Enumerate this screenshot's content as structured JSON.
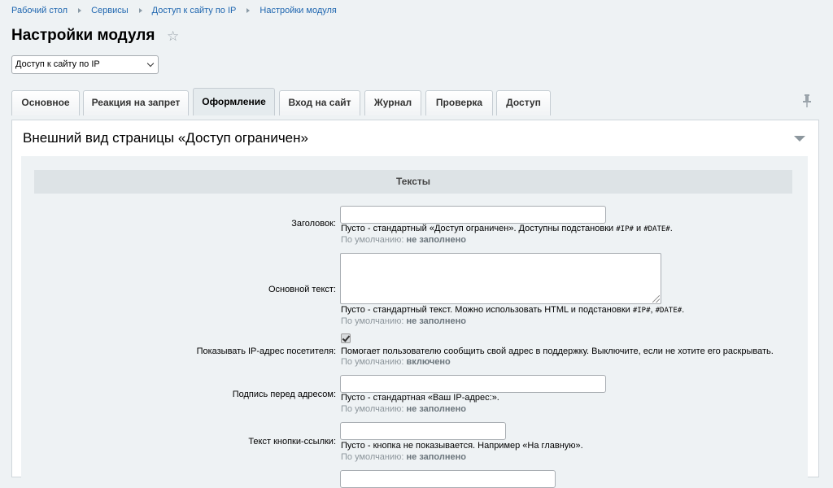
{
  "breadcrumb": [
    "Рабочий стол",
    "Сервисы",
    "Доступ к сайту по IP",
    "Настройки модуля"
  ],
  "page_title": "Настройки модуля",
  "module_select": {
    "value": "Доступ к сайту по IP"
  },
  "tabs": [
    {
      "label": "Основное"
    },
    {
      "label": "Реакция на запрет"
    },
    {
      "label": "Оформление",
      "active": true
    },
    {
      "label": "Вход на сайт"
    },
    {
      "label": "Журнал"
    },
    {
      "label": "Проверка"
    },
    {
      "label": "Доступ"
    }
  ],
  "section": {
    "title": "Внешний вид страницы «Доступ ограничен»",
    "group_title": "Тексты"
  },
  "fields": {
    "heading": {
      "label": "Заголовок:",
      "value": "",
      "hint_text": "Пусто - стандартный «Доступ ограничен». Доступны подстановки ",
      "hint_code1": "#IP#",
      "hint_mid": " и ",
      "hint_code2": "#DATE#",
      "hint_end": ".",
      "default_label": "По умолчанию:",
      "default_value": "не заполнено"
    },
    "main_text": {
      "label": "Основной текст:",
      "value": "",
      "hint_text": "Пусто - стандартный текст. Можно использовать HTML и подстановки ",
      "hint_code1": "#IP#",
      "hint_mid": ", ",
      "hint_code2": "#DATE#",
      "hint_end": ".",
      "default_label": "По умолчанию:",
      "default_value": "не заполнено"
    },
    "show_ip": {
      "label": "Показывать IP-адрес посетителя:",
      "checked": true,
      "hint_text": "Помогает пользователю сообщить свой адрес в поддержку. Выключите, если не хотите его раскрывать.",
      "default_label": "По умолчанию:",
      "default_value": "включено"
    },
    "ip_caption": {
      "label": "Подпись перед адресом:",
      "value": "",
      "hint_text": "Пусто - стандартная «Ваш IP-адрес:».",
      "default_label": "По умолчанию:",
      "default_value": "не заполнено"
    },
    "link_button": {
      "label": "Текст кнопки-ссылки:",
      "value": "",
      "hint_text": "Пусто - кнопка не показывается. Например «На главную».",
      "default_label": "По умолчанию:",
      "default_value": "не заполнено"
    }
  },
  "icons": {
    "star": "star-icon",
    "pin": "pin-icon",
    "collapse": "triangle-down-icon",
    "select": "chevron-down-icon"
  }
}
